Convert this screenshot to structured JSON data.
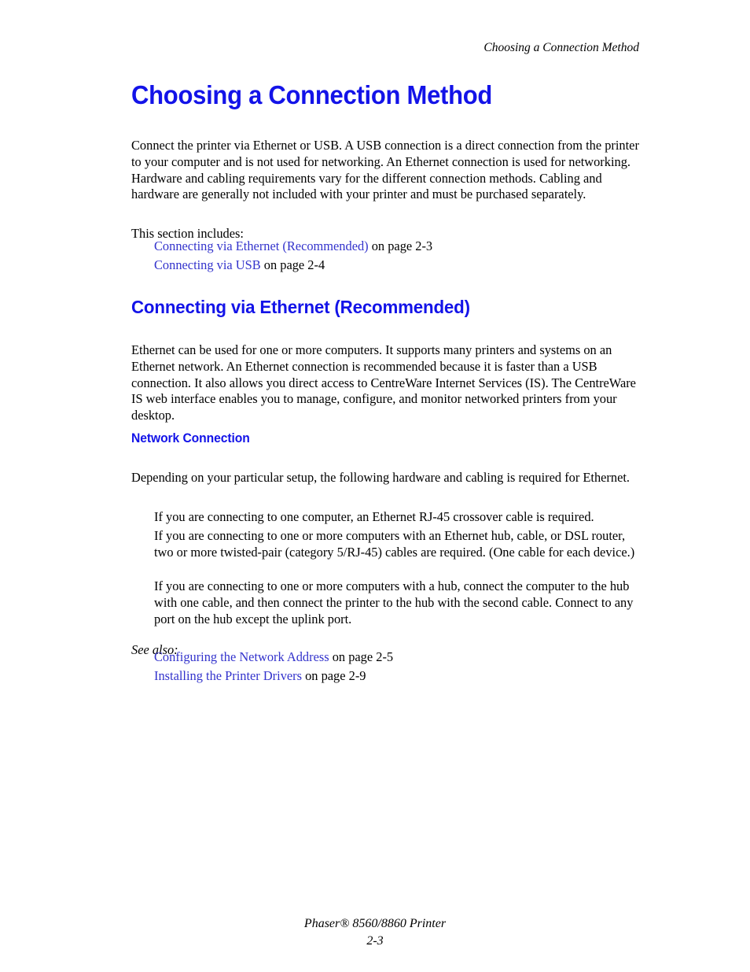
{
  "header": {
    "running_title": "Choosing a Connection Method"
  },
  "colors": {
    "heading_blue": "#1313E8",
    "link_blue": "#3333CC",
    "body_text": "#000000",
    "page_background": "#ffffff"
  },
  "main": {
    "title": "Choosing a Connection Method",
    "intro_paragraph": "Connect the printer via Ethernet or USB. A USB connection is a direct connection from the printer to your computer and is not used for networking. An Ethernet connection is used for networking. Hardware and cabling requirements vary for the different connection methods. Cabling and hardware are generally not included with your printer and must be purchased separately.",
    "section_lead": "This section includes:",
    "section_links": [
      {
        "label": "Connecting via Ethernet (Recommended)",
        "suffix": " on page 2-3"
      },
      {
        "label": "Connecting via USB",
        "suffix": " on page 2-4"
      }
    ],
    "ethernet_section": {
      "title": "Connecting via Ethernet (Recommended)",
      "paragraph": "Ethernet can be used for one or more computers. It supports many printers and systems on an Ethernet network. An Ethernet connection is recommended because it is faster than a USB connection. It also allows you direct access to CentreWare Internet Services (IS). The CentreWare IS web interface enables you to manage, configure, and monitor networked printers from your desktop."
    },
    "network_connection": {
      "title": "Network Connection",
      "paragraph": "Depending on your particular setup, the following hardware and cabling is required for Ethernet.",
      "items": [
        "If you are connecting to one computer, an Ethernet RJ-45 crossover cable is required.",
        "If you are connecting to one or more computers with an Ethernet hub, cable, or DSL router, two or more twisted-pair (category 5/RJ-45) cables are required. (One cable for each device.)",
        "If you are connecting to one or more computers with a hub, connect the computer to the hub with one cable, and then connect the printer to the hub with the second cable. Connect to any port on the hub except the uplink port."
      ]
    },
    "see_also": {
      "label": "See also:",
      "links": [
        {
          "label": "Configuring the Network Address",
          "suffix": " on page 2-5"
        },
        {
          "label": "Installing the Printer Drivers",
          "suffix": " on page 2-9"
        }
      ]
    }
  },
  "footer": {
    "product": "Phaser® 8560/8860 Printer",
    "page_number": "2-3"
  }
}
